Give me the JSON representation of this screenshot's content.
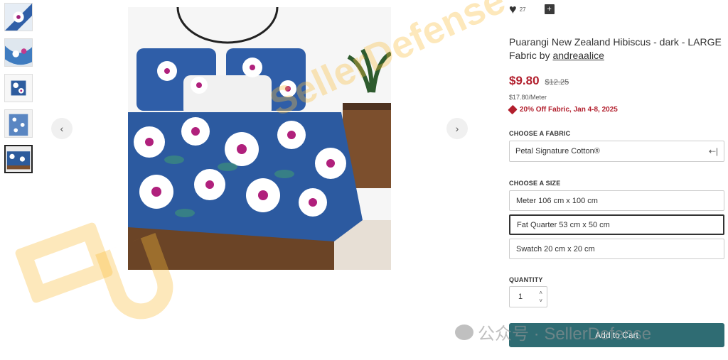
{
  "product": {
    "title_prefix": "Puarangi New Zealand ",
    "title_highlight": "Hibiscus - dark",
    "title_suffix": " - LARGE",
    "fabric_by": "Fabric by ",
    "designer": "andreaalice"
  },
  "social": {
    "favorites_count": "27",
    "heart_icon": "♥",
    "add_icon": "+"
  },
  "pricing": {
    "price": "$9.80",
    "original_price": "$12.25",
    "per_meter": "$17.80/Meter",
    "promo": "20% Off Fabric, Jan 4-8, 2025"
  },
  "fabric": {
    "label": "CHOOSE A FABRIC",
    "selected": "Petal Signature Cotton®",
    "arrow": "⇠|"
  },
  "size": {
    "label": "CHOOSE A SIZE",
    "options": [
      {
        "label": "Meter 106 cm x 100 cm"
      },
      {
        "label": "Fat Quarter 53 cm x 50 cm"
      },
      {
        "label": "Swatch 20 cm x 20 cm"
      }
    ],
    "selected_index": 1
  },
  "quantity": {
    "label": "QUANTITY",
    "value": "1",
    "up": "˄",
    "down": "˅"
  },
  "cart": {
    "label": "Add to Cart"
  },
  "carousel": {
    "prev": "‹",
    "next": "›"
  },
  "watermark": {
    "text": "SellerDefense",
    "wechat": "公众号 · SellerDefense"
  },
  "colors": {
    "accent": "#2f6c73",
    "price": "#b21f2d"
  }
}
